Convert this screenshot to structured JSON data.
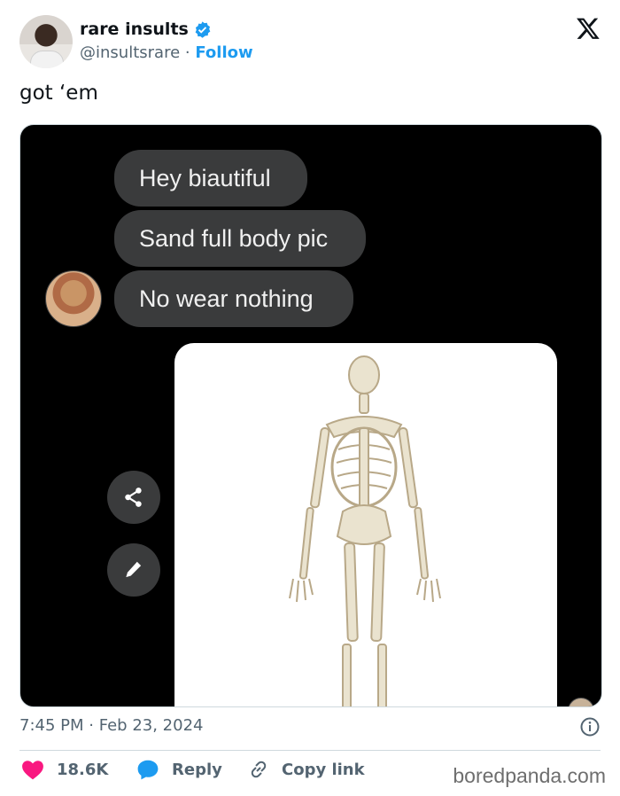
{
  "author": {
    "display_name": "rare insults",
    "handle": "@insultsrare",
    "separator": "·",
    "follow_label": "Follow",
    "verified_icon": "verified-badge-icon",
    "accent_color": "#1d9bf0"
  },
  "tweet": {
    "text": "got ‘em",
    "time": "7:45 PM",
    "date": "Feb 23, 2024",
    "date_separator": "·"
  },
  "media": {
    "messages": [
      "Hey biautiful",
      "Sand full body pic",
      "No wear nothing"
    ],
    "share_icon": "share-icon",
    "edit_icon": "pencil-icon"
  },
  "actions": {
    "likes": "18.6K",
    "reply_label": "Reply",
    "copy_link_label": "Copy link",
    "like_color": "#f91880"
  },
  "watermark": "boredpanda.com"
}
